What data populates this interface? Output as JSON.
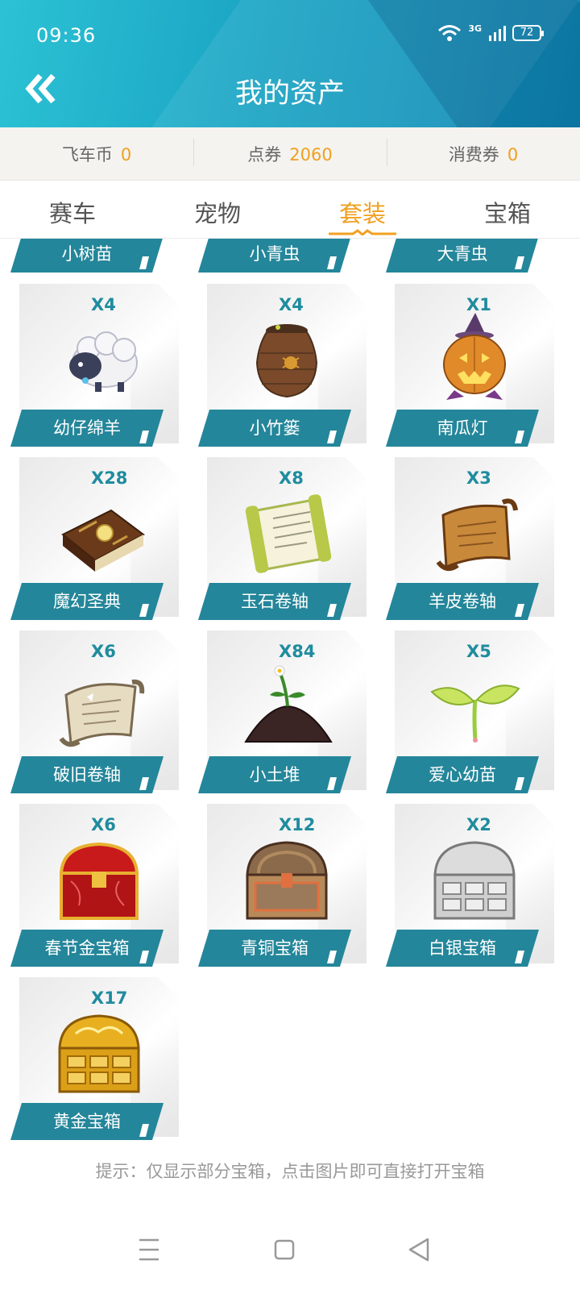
{
  "status": {
    "time": "09:36",
    "network": "3G",
    "battery": "72"
  },
  "header": {
    "title": "我的资产"
  },
  "currency": [
    {
      "label": "飞车币",
      "value": "0"
    },
    {
      "label": "点券",
      "value": "2060"
    },
    {
      "label": "消费券",
      "value": "0"
    }
  ],
  "tabs": [
    {
      "label": "赛车",
      "active": false
    },
    {
      "label": "宠物",
      "active": false
    },
    {
      "label": "套装",
      "active": true
    },
    {
      "label": "宝箱",
      "active": false
    }
  ],
  "partial_items": [
    {
      "name": "小树苗"
    },
    {
      "name": "小青虫"
    },
    {
      "name": "大青虫"
    }
  ],
  "items": [
    {
      "name": "幼仔绵羊",
      "count": "X4",
      "icon": "sheep-icon"
    },
    {
      "name": "小竹篓",
      "count": "X4",
      "icon": "basket-icon"
    },
    {
      "name": "南瓜灯",
      "count": "X1",
      "icon": "pumpkin-icon"
    },
    {
      "name": "魔幻圣典",
      "count": "X28",
      "icon": "spellbook-icon"
    },
    {
      "name": "玉石卷轴",
      "count": "X8",
      "icon": "jade-scroll-icon"
    },
    {
      "name": "羊皮卷轴",
      "count": "X3",
      "icon": "parchment-scroll-icon"
    },
    {
      "name": "破旧卷轴",
      "count": "X6",
      "icon": "old-scroll-icon"
    },
    {
      "name": "小土堆",
      "count": "X84",
      "icon": "dirt-mound-icon"
    },
    {
      "name": "爱心幼苗",
      "count": "X5",
      "icon": "sprout-icon"
    },
    {
      "name": "春节金宝箱",
      "count": "X6",
      "icon": "red-chest-icon"
    },
    {
      "name": "青铜宝箱",
      "count": "X12",
      "icon": "bronze-chest-icon"
    },
    {
      "name": "白银宝箱",
      "count": "X2",
      "icon": "silver-chest-icon"
    },
    {
      "name": "黄金宝箱",
      "count": "X17",
      "icon": "gold-chest-icon"
    }
  ],
  "hint": "提示：仅显示部分宝箱，点击图片即可直接打开宝箱",
  "colors": {
    "accent": "#f0a020",
    "label_bg": "#24869a",
    "count": "#1f8c9e"
  }
}
